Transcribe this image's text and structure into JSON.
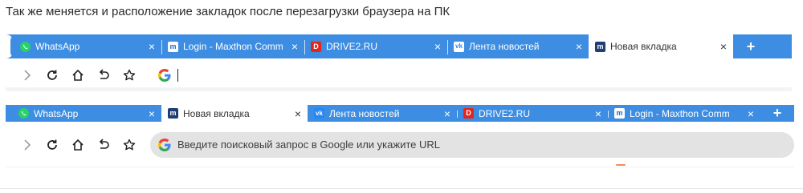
{
  "caption": "Так же меняется и расположение закладок после перезагрузки браузера на ПК",
  "colors": {
    "tabstrip": "#3d8de2",
    "tab_text": "#ffffff",
    "active_tab_bg": "#ffffff",
    "address_bg_focused": "#e3e3e3"
  },
  "browser_before": {
    "tabs": [
      {
        "icon": "whatsapp-icon",
        "title": "WhatsApp",
        "close": "×",
        "active": false
      },
      {
        "icon": "maxthon-icon",
        "title": "Login - Maxthon Comm",
        "close": "×",
        "active": false
      },
      {
        "icon": "drive2-icon",
        "title": "DRIVE2.RU",
        "close": "×",
        "active": false
      },
      {
        "icon": "vk-icon",
        "title": "Лента новостей",
        "close": "×",
        "active": false
      },
      {
        "icon": "maxthon-icon",
        "title": "Новая вкладка",
        "close": "×",
        "active": true
      }
    ],
    "new_tab": "+",
    "address_value": ""
  },
  "browser_after": {
    "tabs": [
      {
        "icon": "whatsapp-icon",
        "title": "WhatsApp",
        "close": "×",
        "active": false
      },
      {
        "icon": "maxthon-icon",
        "title": "Новая вкладка",
        "close": "×",
        "active": true
      },
      {
        "icon": "vk-icon",
        "title": "Лента новостей",
        "close": "×",
        "active": false
      },
      {
        "icon": "drive2-icon",
        "title": "DRIVE2.RU",
        "close": "×",
        "active": false
      },
      {
        "icon": "maxthon-icon",
        "title": "Login - Maxthon Comm",
        "close": "×",
        "active": false
      }
    ],
    "new_tab": "+",
    "address_placeholder": "Введите поисковый запрос в Google или укажите URL"
  },
  "favicon_glyphs": {
    "maxthon": "m",
    "drive2": "D",
    "vk": "vk"
  }
}
